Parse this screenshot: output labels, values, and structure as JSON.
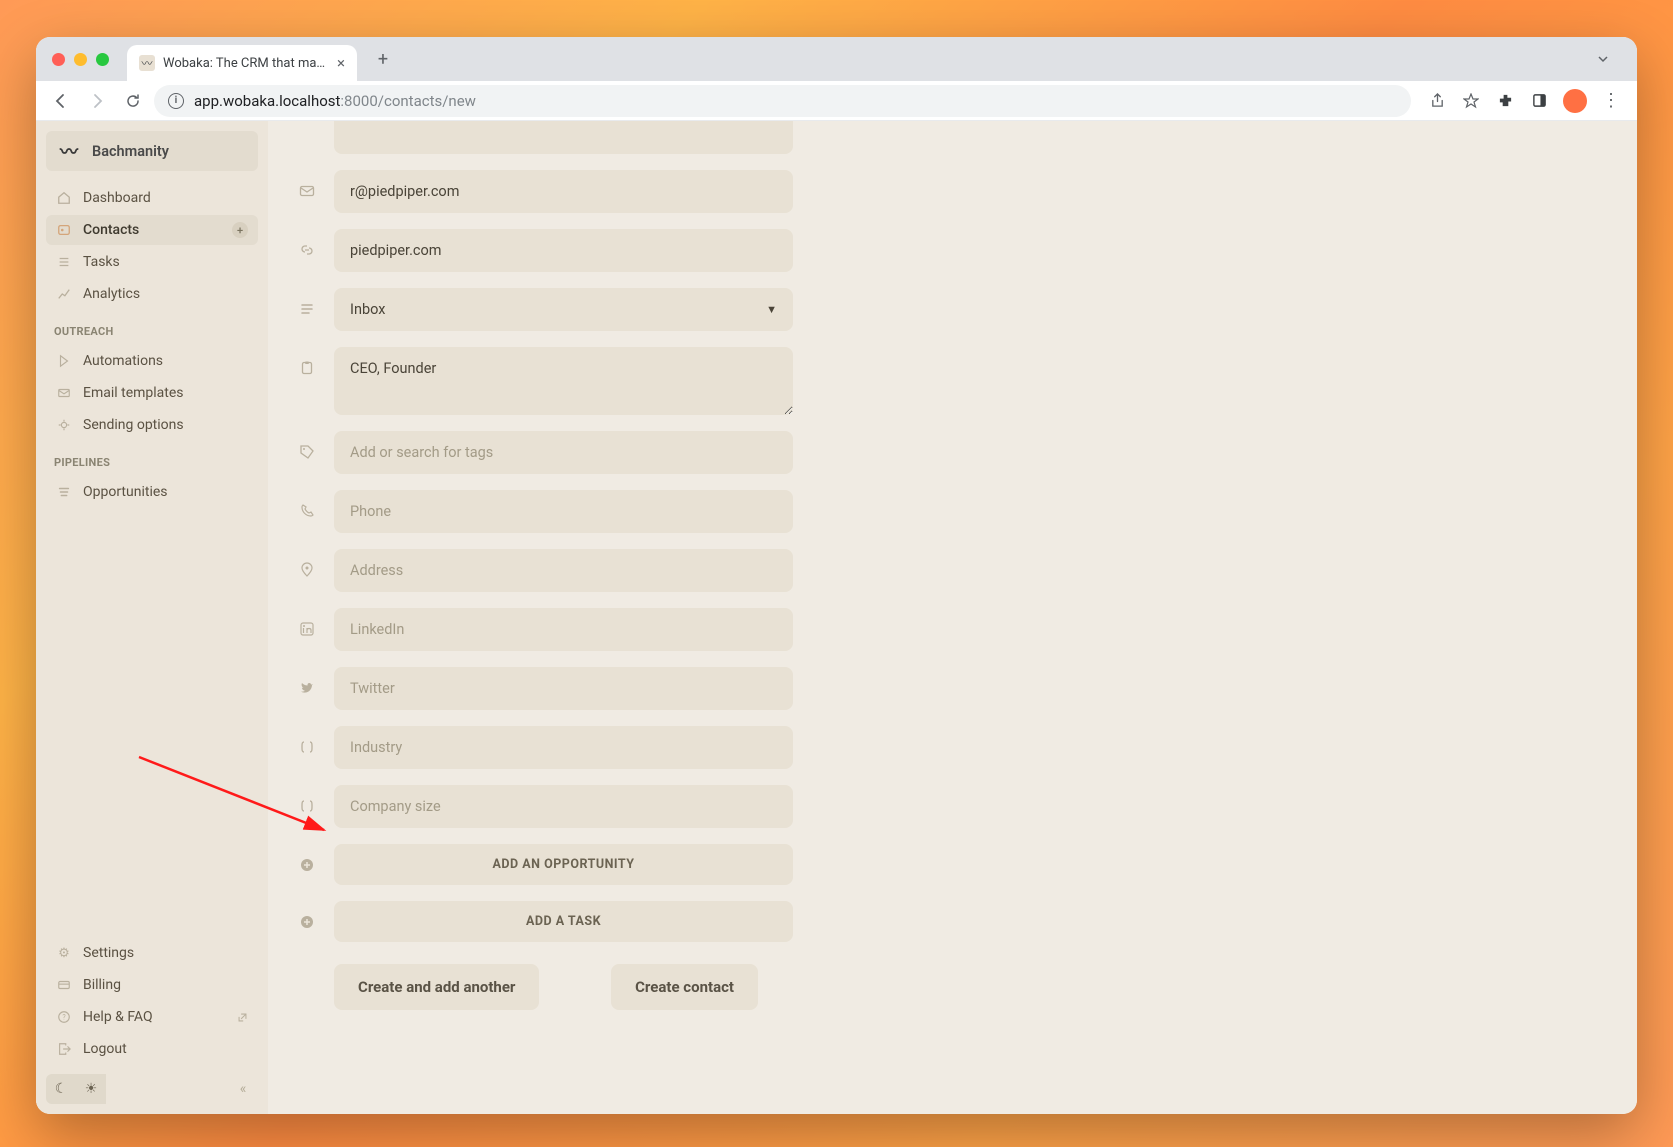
{
  "browser": {
    "tab_title": "Wobaka: The CRM that makes",
    "url_host": "app.wobaka.localhost",
    "url_port": ":8000",
    "url_path": "/contacts/new"
  },
  "workspace": {
    "name": "Bachmanity"
  },
  "nav": {
    "dashboard": "Dashboard",
    "contacts": "Contacts",
    "tasks": "Tasks",
    "analytics": "Analytics",
    "outreach_label": "OUTREACH",
    "automations": "Automations",
    "email_templates": "Email templates",
    "sending_options": "Sending options",
    "pipelines_label": "PIPELINES",
    "opportunities": "Opportunities",
    "settings": "Settings",
    "billing": "Billing",
    "help": "Help & FAQ",
    "logout": "Logout"
  },
  "form": {
    "email_value": "r@piedpiper.com",
    "website_value": "piedpiper.com",
    "status_value": "Inbox",
    "notes_value": "CEO, Founder",
    "tags_placeholder": "Add or search for tags",
    "phone_placeholder": "Phone",
    "address_placeholder": "Address",
    "linkedin_placeholder": "LinkedIn",
    "twitter_placeholder": "Twitter",
    "industry_placeholder": "Industry",
    "company_size_placeholder": "Company size",
    "add_opportunity_label": "ADD AN OPPORTUNITY",
    "add_task_label": "ADD A TASK"
  },
  "actions": {
    "create_another": "Create and add another",
    "create": "Create contact"
  }
}
